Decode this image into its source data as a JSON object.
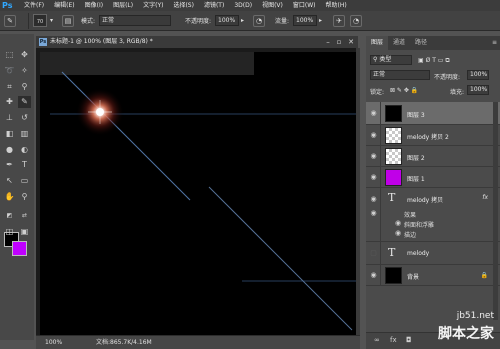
{
  "app": {
    "logo": "Ps"
  },
  "menu": [
    "文件(F)",
    "编辑(E)",
    "图像(I)",
    "图层(L)",
    "文字(Y)",
    "选择(S)",
    "滤镜(T)",
    "3D(D)",
    "视图(V)",
    "窗口(W)",
    "帮助(H)"
  ],
  "options": {
    "brush_size": "70",
    "mode_label": "模式:",
    "mode_value": "正常",
    "opacity_label": "不透明度:",
    "opacity_value": "100%",
    "flow_label": "流量:",
    "flow_value": "100%"
  },
  "document": {
    "title": "未标题-1 @ 100% (图层 3, RGB/8) *",
    "zoom": "100%",
    "info": "文档:865.7K/4.16M"
  },
  "colors": {
    "foreground": "#000000",
    "background": "#c000ff",
    "accent": "#31a8ff"
  },
  "layers_panel": {
    "tabs": [
      "图层",
      "通道",
      "路径"
    ],
    "filter_label": "类型",
    "blend_mode": "正常",
    "opacity_label": "不透明度:",
    "opacity_value": "100%",
    "lock_label": "锁定:",
    "fill_label": "填充:",
    "fill_value": "100%",
    "layers": [
      {
        "name": "图层 3",
        "thumb": "black",
        "selected": true,
        "visible": true
      },
      {
        "name": "melody 拷贝 2",
        "thumb": "checker",
        "visible": true
      },
      {
        "name": "图层 2",
        "thumb": "checker",
        "visible": true
      },
      {
        "name": "图层 1",
        "thumb": "purple",
        "visible": true
      },
      {
        "name": "melody 拷贝",
        "thumb": "text",
        "visible": true,
        "fx": "fx"
      },
      {
        "name": "melody",
        "thumb": "text",
        "visible": false
      },
      {
        "name": "背景",
        "thumb": "black",
        "visible": true,
        "locked": true
      }
    ],
    "effects": {
      "title": "效果",
      "items": [
        "斜面和浮雕",
        "描边"
      ]
    }
  },
  "watermark": {
    "url": "jb51.net",
    "name": "脚本之家"
  }
}
